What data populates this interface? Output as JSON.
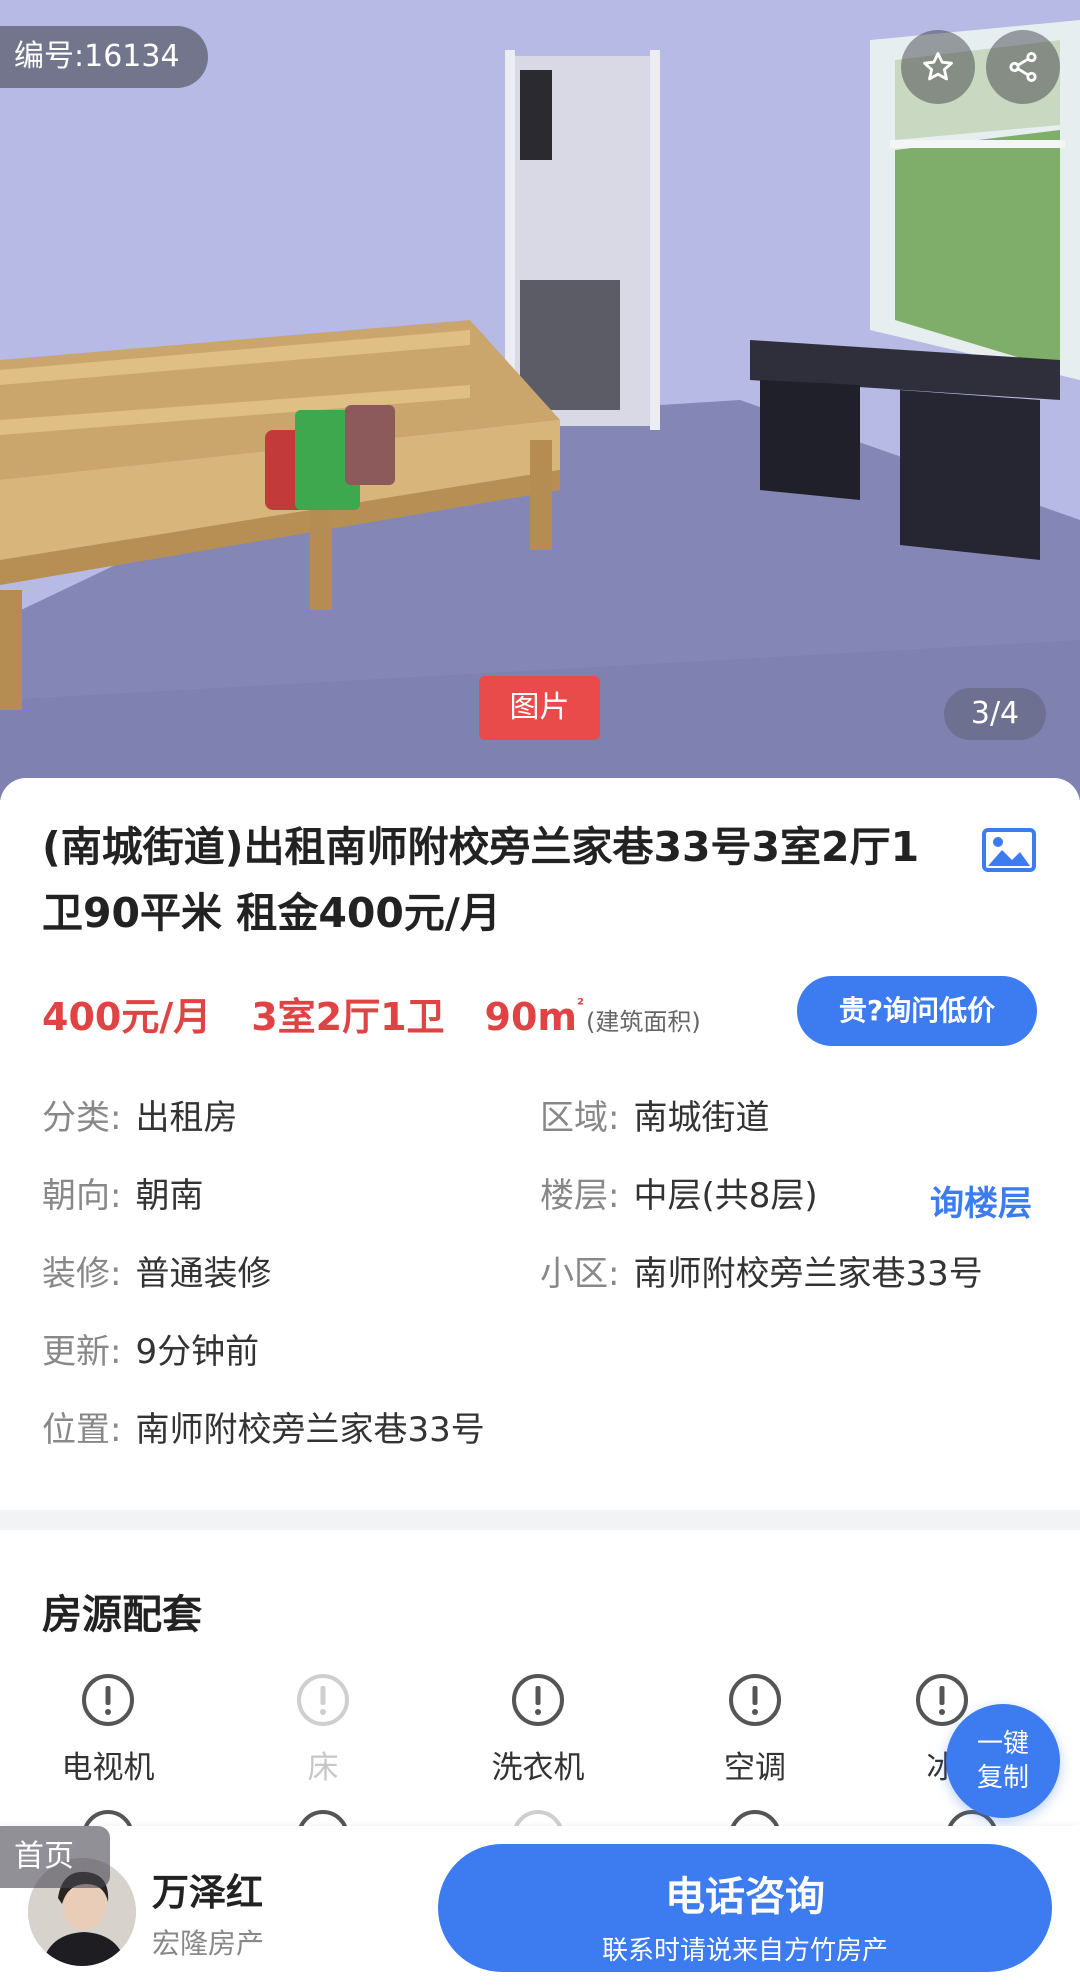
{
  "hero": {
    "id_badge": "编号:16134",
    "image_tag": "图片",
    "counter": "3/4",
    "favorite_icon": "star-icon",
    "share_icon": "share-icon"
  },
  "listing": {
    "title": "(南城街道)出租南师附校旁兰家巷33号3室2厅1卫90平米 租金400元/月",
    "price": "400元/月",
    "layout": "3室2厅1卫",
    "area": "90m",
    "area_sup": "²",
    "area_note": "(建筑面积)",
    "ask_price_button": "贵?询问低价",
    "gallery_icon": "gallery-icon"
  },
  "details": {
    "category_key": "分类:",
    "category_value": "出租房",
    "region_key": "区域:",
    "region_value": "南城街道",
    "orientation_key": "朝向:",
    "orientation_value": "朝南",
    "floor_key": "楼层:",
    "floor_value": "中层(共8层)",
    "ask_floor": "询楼层",
    "decoration_key": "装修:",
    "decoration_value": "普通装修",
    "community_key": "小区:",
    "community_value": "南师附校旁兰家巷33号",
    "updated_key": "更新:",
    "updated_value": "9分钟前",
    "location_key": "位置:",
    "location_value": "南师附校旁兰家巷33号"
  },
  "facilities": {
    "title": "房源配套",
    "items": [
      {
        "label": "电视机",
        "available": true
      },
      {
        "label": "床",
        "available": false
      },
      {
        "label": "洗衣机",
        "available": true
      },
      {
        "label": "空调",
        "available": true
      },
      {
        "label": "冰",
        "available": true
      }
    ],
    "copy_button_line1": "一键",
    "copy_button_line2": "复制"
  },
  "bottom_bar": {
    "home_tag": "首页",
    "agent_name": "万泽红",
    "agent_company": "宏隆房产",
    "call_title": "电话咨询",
    "call_subtitle": "联系时请说来自方竹房产"
  },
  "colors": {
    "accent": "#3d7bf0",
    "price_red": "#e04343",
    "tag_red": "#e94a4a"
  }
}
